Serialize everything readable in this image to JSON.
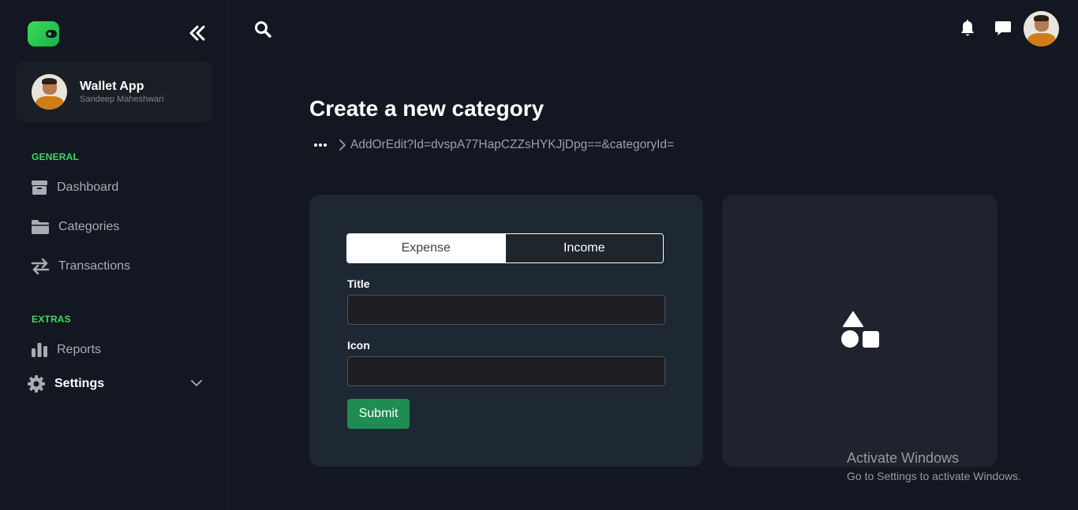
{
  "sidebar": {
    "logo": {
      "icon": "wallet-icon",
      "color": "#3ddc5a"
    },
    "collapse_icon": "double-chevron-left-icon",
    "profile": {
      "name": "Wallet App",
      "subtitle": "Sandeep Maheshwari"
    },
    "sections": [
      {
        "label": "GENERAL",
        "items": [
          {
            "label": "Dashboard",
            "icon": "box-icon"
          },
          {
            "label": "Categories",
            "icon": "folder-icon"
          },
          {
            "label": "Transactions",
            "icon": "exchange-arrows-icon"
          }
        ]
      },
      {
        "label": "EXTRAS",
        "items": [
          {
            "label": "Reports",
            "icon": "bar-chart-icon"
          },
          {
            "label": "Settings",
            "icon": "gear-icon",
            "active": true,
            "expandable": true
          }
        ]
      }
    ],
    "accent_color": "#3ddc5a"
  },
  "header": {
    "search_icon": "search-icon",
    "notification_icon": "bell-icon",
    "message_icon": "chat-icon"
  },
  "main": {
    "title": "Create a new category",
    "breadcrumb": {
      "more_icon": "ellipsis-icon",
      "separator_icon": "chevron-right-icon",
      "current": "AddOrEdit?Id=dvspA77HapCZZsHYKJjDpg==&categoryId="
    },
    "form": {
      "type_options": [
        "Expense",
        "Income"
      ],
      "selected_type": "Expense",
      "title_label": "Title",
      "title_value": "",
      "icon_label": "Icon",
      "icon_value": "",
      "submit_label": "Submit",
      "submit_color": "#1e8d52"
    },
    "preview": {
      "icon": "shapes-icon"
    }
  },
  "watermark": {
    "title": "Activate Windows",
    "subtitle": "Go to Settings to activate Windows."
  }
}
